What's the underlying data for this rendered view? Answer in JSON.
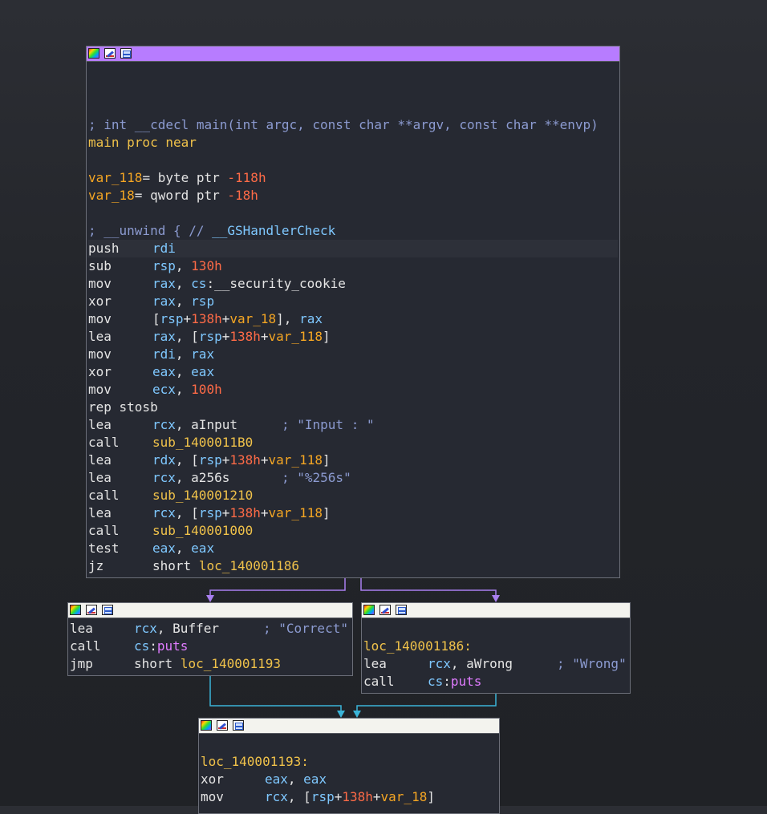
{
  "colors": {
    "background": "#23252a",
    "node_bg": "#262932",
    "main_titlebar": "#b77cff",
    "sub_titlebar": "#f3f3ee",
    "edge_true": "#a97ff0",
    "edge_merge": "#3ab4d8",
    "mnemonic": "#e4e4e4",
    "register": "#7fc8ff",
    "number": "#ff6b47",
    "variable": "#f5a623",
    "label": "#f0c24a",
    "comment": "#8c9bd1",
    "import": "#e07cff"
  },
  "node_icons": [
    "color-palette-icon",
    "edit-icon",
    "graph-view-icon"
  ],
  "main_block": {
    "signature_comment": "; int __cdecl main(int argc, const char **argv, const char **envp)",
    "proc_decl": "main proc near",
    "var1_name": "var_118",
    "var1_def": "= byte ptr ",
    "var1_off": "-118h",
    "var2_name": "var_18",
    "var2_def": "= qword ptr ",
    "var2_off": "-18h",
    "unwind_comment": "; __unwind { // ",
    "unwind_handler": "__GSHandlerCheck",
    "instructions": [
      {
        "mn": "push",
        "ops": "rdi"
      },
      {
        "mn": "sub",
        "ops": "rsp, 130h"
      },
      {
        "mn": "mov",
        "ops": "rax, cs:__security_cookie"
      },
      {
        "mn": "xor",
        "ops": "rax, rsp"
      },
      {
        "mn": "mov",
        "ops": "[rsp+138h+var_18], rax"
      },
      {
        "mn": "lea",
        "ops": "rax, [rsp+138h+var_118]"
      },
      {
        "mn": "mov",
        "ops": "rdi, rax"
      },
      {
        "mn": "xor",
        "ops": "eax, eax"
      },
      {
        "mn": "mov",
        "ops": "ecx, 100h"
      },
      {
        "mn": "rep stosb",
        "ops": ""
      },
      {
        "mn": "lea",
        "ops": "rcx, aInput",
        "comment": "; \"Input : \""
      },
      {
        "mn": "call",
        "ops": "sub_1400011B0"
      },
      {
        "mn": "lea",
        "ops": "rdx, [rsp+138h+var_118]"
      },
      {
        "mn": "lea",
        "ops": "rcx, a256s",
        "comment": "; \"%256s\""
      },
      {
        "mn": "call",
        "ops": "sub_140001210"
      },
      {
        "mn": "lea",
        "ops": "rcx, [rsp+138h+var_118]"
      },
      {
        "mn": "call",
        "ops": "sub_140001000"
      },
      {
        "mn": "test",
        "ops": "eax, eax"
      },
      {
        "mn": "jz",
        "ops": "short loc_140001186"
      }
    ]
  },
  "correct_block": {
    "instructions": [
      {
        "mn": "lea",
        "ops": "rcx, Buffer",
        "comment": "; \"Correct\""
      },
      {
        "mn": "call",
        "ops": "cs:puts"
      },
      {
        "mn": "jmp",
        "ops": "short loc_140001193"
      }
    ]
  },
  "wrong_block": {
    "label": "loc_140001186:",
    "instructions": [
      {
        "mn": "lea",
        "ops": "rcx, aWrong",
        "comment": "; \"Wrong\""
      },
      {
        "mn": "call",
        "ops": "cs:puts"
      }
    ]
  },
  "exit_block": {
    "label": "loc_140001193:",
    "instructions": [
      {
        "mn": "xor",
        "ops": "eax, eax"
      },
      {
        "mn": "mov",
        "ops": "rcx, [rsp+138h+var_18]"
      }
    ]
  }
}
